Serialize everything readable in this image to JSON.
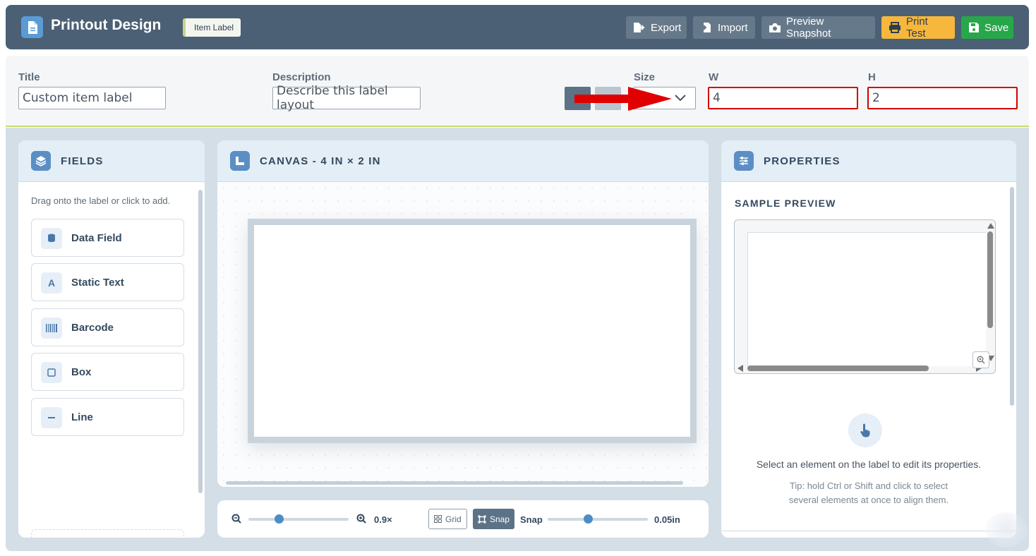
{
  "header": {
    "app_title": "Printout Design",
    "badge": "Item Label",
    "buttons": {
      "export": "Export",
      "import": "Import",
      "preview": "Preview Snapshot",
      "print_test": "Print Test",
      "save": "Save"
    }
  },
  "toolbar": {
    "title_label": "Title",
    "title_value": "Custom item label",
    "description_label": "Description",
    "description_value": "Describe this label layout",
    "size_label": "Size",
    "size_value": "",
    "w_label": "W",
    "w_value": "4",
    "h_label": "H",
    "h_value": "2"
  },
  "fields_panel": {
    "title": "FIELDS",
    "hint": "Drag onto the label or click to add.",
    "items": [
      {
        "label": "Data Field",
        "icon": "database-icon"
      },
      {
        "label": "Static Text",
        "icon": "text-icon"
      },
      {
        "label": "Barcode",
        "icon": "barcode-icon"
      },
      {
        "label": "Box",
        "icon": "square-icon"
      },
      {
        "label": "Line",
        "icon": "line-icon"
      }
    ]
  },
  "canvas_panel": {
    "title": "CANVAS - 4 IN × 2 IN"
  },
  "zoom_bar": {
    "zoom_value": "0.9×",
    "zoom_level": 0.3,
    "grid_label": "Grid",
    "snap_button_label": "Snap",
    "snap_label": "Snap",
    "snap_value": "0.05in",
    "snap_level": 0.4
  },
  "properties_panel": {
    "title": "PROPERTIES",
    "sample_preview_title": "SAMPLE PREVIEW",
    "empty_message": "Select an element on the label to edit its properties.",
    "tip_line1": "Tip: hold Ctrl or Shift and click to select",
    "tip_line2": "several elements at once to align them."
  },
  "colors": {
    "header_bg": "#4b6074",
    "print_button": "#f6b73c",
    "save_button": "#27a74a",
    "accent_blue": "#5b8ec4",
    "highlight_red": "#d40000"
  }
}
